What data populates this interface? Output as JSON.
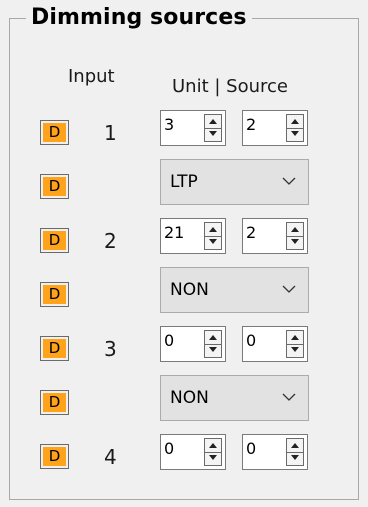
{
  "group": {
    "title": "Dimming sources"
  },
  "headers": {
    "input": "Input",
    "unit_source": "Unit | Source"
  },
  "button_label": "D",
  "rows": [
    {
      "input": "1",
      "unit": "3",
      "source": "2"
    },
    {
      "combo": "LTP"
    },
    {
      "input": "2",
      "unit": "21",
      "source": "2"
    },
    {
      "combo": "NON"
    },
    {
      "input": "3",
      "unit": "0",
      "source": "0"
    },
    {
      "combo": "NON"
    },
    {
      "input": "4",
      "unit": "0",
      "source": "0"
    }
  ],
  "colors": {
    "button_fill": "#ffa31a",
    "background": "#f0f0f0"
  },
  "icons": {
    "spin_up": "triangle-up-icon",
    "spin_down": "triangle-down-icon",
    "combo_arrow": "chevron-down-icon"
  }
}
